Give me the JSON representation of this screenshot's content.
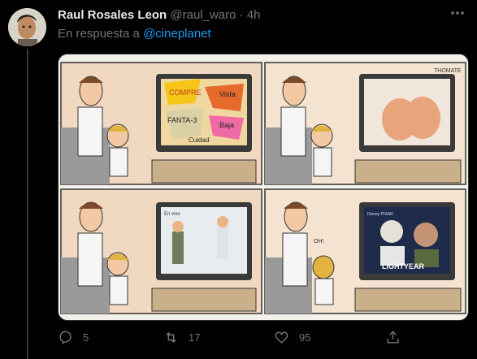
{
  "tweet": {
    "name": "Raul Rosales Leon",
    "handle": "@raul_waro",
    "separator": "·",
    "time": "4h",
    "reply_prefix": "En respuesta a",
    "reply_to": "@cineplanet"
  },
  "media": {
    "signature": "THOMATE",
    "panel1_words": [
      "COMPRE",
      "Vista",
      "FANTA-3",
      "Baja",
      "Cuidad",
      "compre"
    ],
    "panel3_caption": "En vivo",
    "panel4_speech": "OH!",
    "panel4_poster": {
      "brand": "Disney PIXAR",
      "title": "LIGHTYEAR"
    }
  },
  "actions": {
    "reply_count": "5",
    "retweet_count": "17",
    "like_count": "95"
  },
  "colors": {
    "background": "#000000",
    "text": "#e7e9ea",
    "muted": "#71767b",
    "link": "#1d9bf0"
  },
  "icons": {
    "more": "more-icon",
    "reply": "reply-icon",
    "retweet": "retweet-icon",
    "like": "like-icon",
    "share": "share-icon"
  }
}
